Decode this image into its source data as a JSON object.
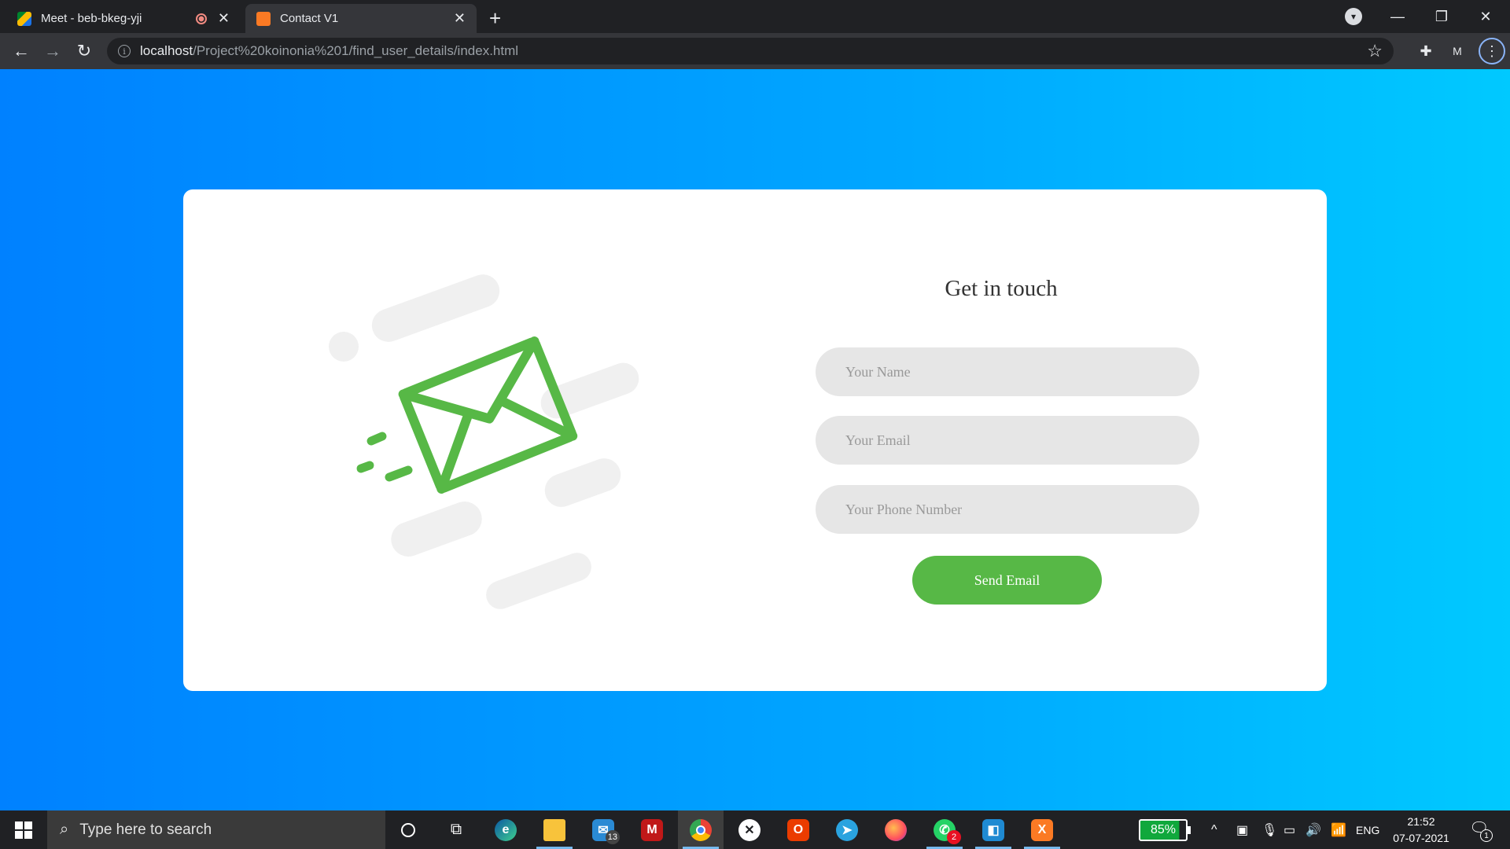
{
  "browser": {
    "tabs": [
      {
        "title": "Meet - beb-bkeg-yji",
        "active": false
      },
      {
        "title": "Contact V1",
        "active": true
      }
    ],
    "url_host": "localhost",
    "url_path": "/Project%20koinonia%201/find_user_details/index.html"
  },
  "form": {
    "title": "Get in touch",
    "name_placeholder": "Your Name",
    "email_placeholder": "Your Email",
    "phone_placeholder": "Your Phone Number",
    "submit_label": "Send Email"
  },
  "colors": {
    "accent_green": "#57b846",
    "bg_gradient_start": "#0081ff",
    "bg_gradient_end": "#00c9ff"
  },
  "taskbar": {
    "search_placeholder": "Type here to search",
    "mail_badge": "13",
    "whatsapp_badge": "2",
    "battery": "85%",
    "language": "ENG",
    "time": "21:52",
    "date": "07-07-2021",
    "notification_count": "1"
  }
}
